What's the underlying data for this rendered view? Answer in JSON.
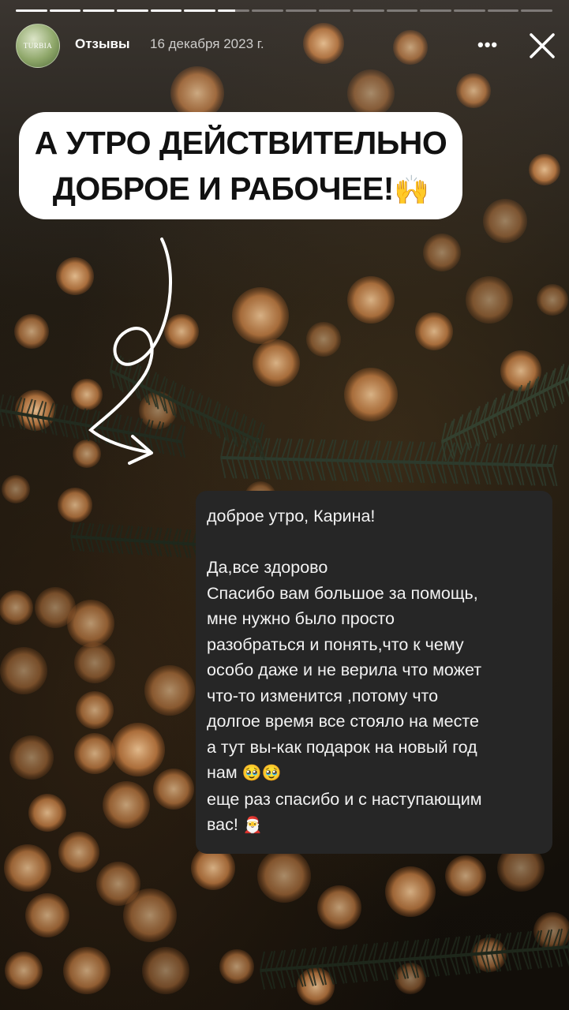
{
  "story": {
    "progress_segments": [
      1,
      1,
      1,
      1,
      1,
      1,
      0.55,
      0,
      0,
      0,
      0,
      0,
      0,
      0,
      0,
      0
    ],
    "account_name": "Отзывы",
    "date": "16 декабря 2023 г.",
    "avatar_text": "TURBIA",
    "more_label": "•••",
    "close_icon": "close-icon"
  },
  "headline": {
    "line1": "А УТРО ДЕЙСТВИТЕЛЬНО",
    "line2": "ДОБРОЕ И РАБОЧЕЕ!",
    "emoji": "🙌"
  },
  "message": {
    "greeting": "доброе утро,  Карина!",
    "lines": [
      "Да,все здорово",
      "Спасибо вам большое за помощь,",
      "мне нужно было просто",
      "разобраться и понять,что к чему",
      "особо даже и не верила что может",
      "что-то изменится ,потому что",
      "долгое время все стояло на месте",
      "а тут вы-как подарок на новый год"
    ],
    "line_nam": "нам",
    "emoji_pleading": "🥹🥹",
    "line_thanks": "еще раз спасибо и с наступающим",
    "line_vas": "вас!",
    "emoji_santa": "🎅"
  },
  "colors": {
    "bokeh": "#f0a865",
    "bubble": "#262626",
    "headline_bg": "#ffffff"
  }
}
